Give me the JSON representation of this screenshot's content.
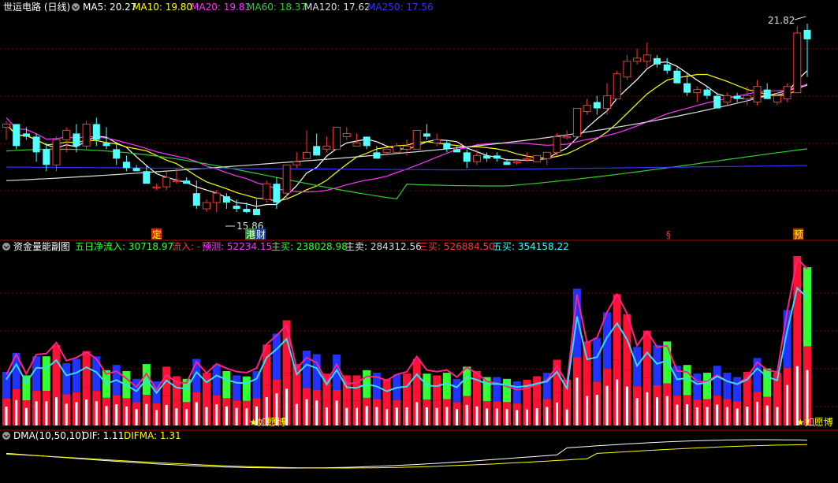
{
  "main": {
    "title": "世运电路 (日线)",
    "ma": [
      {
        "label": "MA5: 20.27",
        "color": "#ffffff"
      },
      {
        "label": "MA10: 19.80",
        "color": "#ffff00"
      },
      {
        "label": "MA20: 19.81",
        "color": "#ff33ff"
      },
      {
        "label": "MA60: 18.37",
        "color": "#33cc33"
      },
      {
        "label": "MA120: 17.62",
        "color": "#dddddd"
      },
      {
        "label": "MA250: 17.56",
        "color": "#3333ff"
      }
    ],
    "high_label": "21.82",
    "low_label": "15.86",
    "markers": [
      {
        "text": "定",
        "bg": "#cc3300"
      },
      {
        "text": "港",
        "bg": "#228822"
      },
      {
        "text": "财",
        "bg": "#1144aa"
      },
      {
        "text": "§",
        "bg": "#000000"
      },
      {
        "text": "预",
        "bg": "#aa4400"
      }
    ]
  },
  "flow": {
    "title": "资金量能副图",
    "items": [
      {
        "label": "五日净流入: 30718.97",
        "color": "#33ff33"
      },
      {
        "label": "流入: -",
        "color": "#ff3333"
      },
      {
        "label": "预测: 52234.15",
        "color": "#ff33ff"
      },
      {
        "label": "主买: 238028.98",
        "color": "#33ff33"
      },
      {
        "label": "主卖: 284312.56",
        "color": "#dddddd"
      },
      {
        "label": "三买: 526884.50",
        "color": "#ff3333"
      },
      {
        "label": "五买: 354158.22",
        "color": "#33ffff"
      }
    ],
    "star_label": "★如愿博"
  },
  "dma": {
    "title": "DMA(10,50,10)",
    "dif": "DIF: 1.11",
    "difma": "DIFMA: 1.31"
  },
  "colors": {
    "up": "#ff3333",
    "down": "#54ffff",
    "grid": "#7f0000",
    "sep": "#bb0000"
  },
  "chart_data": {
    "type": "candlestick",
    "candles": [
      [
        18.6,
        18.8,
        18.2,
        18.7
      ],
      [
        18.7,
        18.7,
        17.9,
        18.0
      ],
      [
        18.4,
        18.6,
        18.2,
        18.3
      ],
      [
        18.3,
        18.4,
        17.5,
        17.8
      ],
      [
        17.9,
        18.1,
        17.2,
        17.4
      ],
      [
        17.4,
        18.3,
        17.2,
        18.2
      ],
      [
        18.2,
        18.6,
        17.8,
        18.5
      ],
      [
        18.4,
        18.7,
        17.8,
        18.0
      ],
      [
        18.0,
        18.8,
        17.9,
        18.7
      ],
      [
        18.7,
        18.9,
        18.0,
        18.2
      ],
      [
        18.1,
        18.6,
        17.9,
        18.0
      ],
      [
        17.9,
        18.1,
        17.4,
        17.6
      ],
      [
        17.5,
        17.7,
        17.2,
        17.3
      ],
      [
        17.3,
        17.4,
        17.2,
        17.2
      ],
      [
        17.2,
        17.4,
        16.8,
        16.8
      ],
      [
        16.7,
        16.8,
        16.6,
        16.7
      ],
      [
        16.7,
        17.2,
        16.6,
        17.0
      ],
      [
        16.9,
        17.3,
        16.8,
        16.9
      ],
      [
        16.9,
        17.0,
        16.8,
        16.8
      ],
      [
        16.5,
        16.9,
        16.0,
        16.1
      ],
      [
        16.0,
        16.3,
        15.9,
        16.2
      ],
      [
        16.2,
        16.6,
        15.9,
        16.5
      ],
      [
        16.4,
        16.5,
        16.0,
        16.2
      ],
      [
        16.1,
        16.3,
        15.9,
        16.0
      ],
      [
        16.0,
        16.2,
        15.86,
        15.9
      ],
      [
        16.0,
        16.3,
        15.8,
        15.8
      ],
      [
        16.3,
        16.9,
        16.2,
        16.8
      ],
      [
        16.8,
        17.0,
        16.0,
        16.2
      ],
      [
        16.5,
        17.4,
        16.3,
        17.4
      ],
      [
        17.4,
        17.8,
        17.3,
        17.5
      ],
      [
        17.6,
        18.5,
        17.6,
        17.8
      ],
      [
        18.0,
        18.4,
        17.8,
        17.7
      ],
      [
        17.9,
        18.3,
        17.8,
        18.0
      ],
      [
        17.9,
        18.6,
        17.9,
        18.6
      ],
      [
        18.3,
        18.6,
        18.2,
        18.4
      ],
      [
        18.0,
        18.4,
        18.0,
        18.1
      ],
      [
        18.3,
        18.3,
        17.9,
        18.0
      ],
      [
        17.8,
        18.0,
        17.6,
        17.6
      ],
      [
        17.8,
        17.9,
        17.7,
        17.9
      ],
      [
        17.8,
        18.1,
        17.8,
        18.0
      ],
      [
        17.9,
        18.2,
        17.7,
        18.0
      ],
      [
        17.9,
        18.5,
        17.9,
        18.5
      ],
      [
        18.4,
        18.7,
        18.2,
        18.3
      ],
      [
        18.1,
        18.4,
        18.0,
        18.2
      ],
      [
        18.1,
        18.2,
        17.8,
        17.9
      ],
      [
        17.9,
        18.0,
        17.8,
        17.8
      ],
      [
        17.8,
        17.9,
        17.3,
        17.5
      ],
      [
        17.5,
        17.9,
        17.4,
        17.7
      ],
      [
        17.7,
        17.8,
        17.5,
        17.6
      ],
      [
        17.7,
        17.8,
        17.5,
        17.6
      ],
      [
        17.5,
        17.6,
        17.4,
        17.4
      ],
      [
        17.5,
        17.6,
        17.4,
        17.5
      ],
      [
        17.6,
        17.8,
        17.5,
        17.6
      ],
      [
        17.5,
        17.7,
        17.5,
        17.7
      ],
      [
        17.6,
        17.8,
        17.4,
        17.8
      ],
      [
        17.8,
        18.4,
        17.7,
        18.3
      ],
      [
        18.3,
        18.5,
        18.2,
        18.3
      ],
      [
        18.3,
        19.2,
        18.3,
        19.2
      ],
      [
        19.1,
        19.5,
        19.0,
        19.3
      ],
      [
        19.4,
        19.6,
        19.0,
        19.2
      ],
      [
        19.2,
        20.0,
        19.0,
        19.6
      ],
      [
        19.5,
        20.4,
        19.5,
        20.3
      ],
      [
        20.2,
        20.9,
        20.1,
        20.7
      ],
      [
        20.7,
        21.1,
        20.6,
        20.8
      ],
      [
        20.7,
        21.3,
        20.5,
        20.9
      ],
      [
        20.8,
        20.9,
        20.5,
        20.6
      ],
      [
        20.6,
        20.8,
        20.3,
        20.4
      ],
      [
        20.4,
        20.5,
        20.0,
        20.0
      ],
      [
        20.0,
        20.3,
        19.6,
        19.7
      ],
      [
        19.7,
        19.9,
        19.4,
        19.8
      ],
      [
        19.8,
        19.9,
        19.5,
        19.6
      ],
      [
        19.6,
        19.7,
        19.2,
        19.2
      ],
      [
        19.4,
        19.7,
        19.3,
        19.6
      ],
      [
        19.6,
        19.7,
        19.4,
        19.5
      ],
      [
        19.5,
        19.9,
        19.3,
        19.6
      ],
      [
        19.4,
        20.1,
        19.3,
        19.9
      ],
      [
        19.8,
        20.0,
        19.5,
        19.5
      ],
      [
        19.4,
        19.7,
        19.3,
        19.6
      ],
      [
        19.5,
        20.0,
        19.4,
        19.9
      ],
      [
        19.7,
        21.82,
        19.7,
        21.6
      ],
      [
        21.7,
        21.9,
        20.2,
        21.4
      ]
    ],
    "y_range": [
      15.5,
      22.2
    ]
  }
}
